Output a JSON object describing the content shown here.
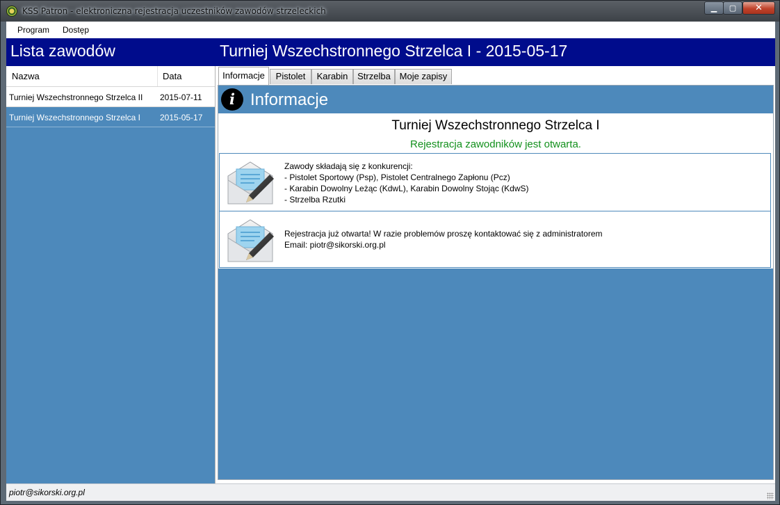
{
  "window": {
    "title": "KSS Patron - elektroniczna rejestracja uczestników zawodów strzeleckich",
    "controls": {
      "minimize": "▁",
      "maximize": "▢",
      "close": "✕"
    }
  },
  "menu": {
    "items": [
      "Program",
      "Dostęp"
    ]
  },
  "header": {
    "left_title": "Lista zawodów",
    "right_title": "Turniej Wszechstronnego Strzelca I - 2015-05-17"
  },
  "competition_list": {
    "columns": {
      "name": "Nazwa",
      "date": "Data"
    },
    "rows": [
      {
        "name": "Turniej Wszechstronnego Strzelca II",
        "date": "2015-07-11",
        "selected": false
      },
      {
        "name": "Turniej Wszechstronnego Strzelca I",
        "date": "2015-05-17",
        "selected": true
      }
    ]
  },
  "tabs": [
    {
      "label": "Informacje",
      "active": true
    },
    {
      "label": "Pistolet",
      "active": false
    },
    {
      "label": "Karabin",
      "active": false
    },
    {
      "label": "Strzelba",
      "active": false
    },
    {
      "label": "Moje zapisy",
      "active": false
    }
  ],
  "info": {
    "heading": "Informacje",
    "icon": "info-icon",
    "competition_name": "Turniej Wszechstronnego Strzelca I",
    "registration_status": "Rejestracja zawodników jest otwarta.",
    "cards": [
      {
        "icon": "envelope-pencil-icon",
        "lines": [
          "Zawody składają się z konkurencji:",
          "- Pistolet Sportowy (Psp), Pistolet Centralnego Zapłonu (Pcz)",
          "- Karabin Dowolny Leżąc (KdwL), Karabin Dowolny Stojąc (KdwS)",
          "- Strzelba Rzutki"
        ]
      },
      {
        "icon": "envelope-pencil-icon",
        "lines": [
          "Rejestracja już otwarta! W razie problemów proszę kontaktować się z administratorem",
          "Email: piotr@sikorski.org.pl"
        ]
      }
    ]
  },
  "statusbar": {
    "user": "piotr@sikorski.org.pl"
  },
  "colors": {
    "header_bg": "#000c8c",
    "panel_bg": "#4d89bb",
    "status_green": "#12901c"
  }
}
